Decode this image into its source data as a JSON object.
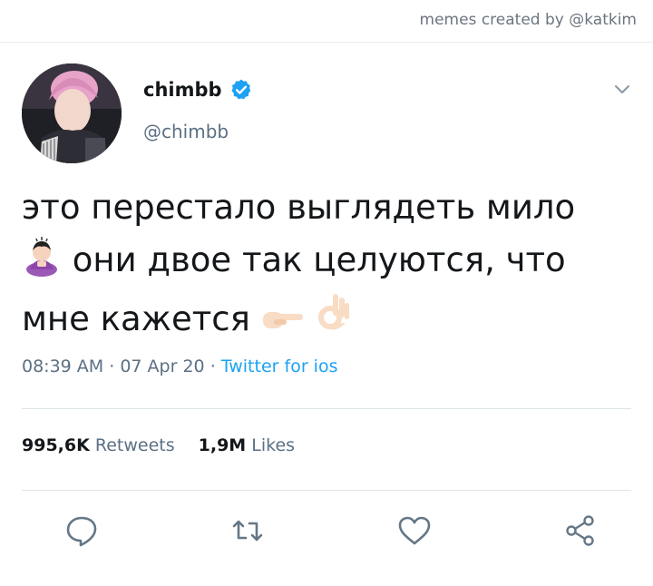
{
  "credit": "memes created by @katkim",
  "author": {
    "name": "chimbb",
    "handle": "@chimbb",
    "verified": true
  },
  "tweet": {
    "line1": "это перестало выглядеть мило",
    "line2": "они двое так целуются, что",
    "line3": "мне кажется"
  },
  "meta": {
    "time": "08:39 AM",
    "date": "07 Apr 20",
    "source": "Twitter for ios"
  },
  "stats": {
    "retweets_count": "995,6K",
    "retweets_label": "Retweets",
    "likes_count": "1,9M",
    "likes_label": "Likes"
  },
  "colors": {
    "accent": "#1da1f2",
    "text": "#14171a",
    "muted": "#5b7083"
  },
  "icons": [
    "verified-badge-icon",
    "chevron-down-icon",
    "reply-icon",
    "retweet-icon",
    "like-icon",
    "share-icon"
  ]
}
